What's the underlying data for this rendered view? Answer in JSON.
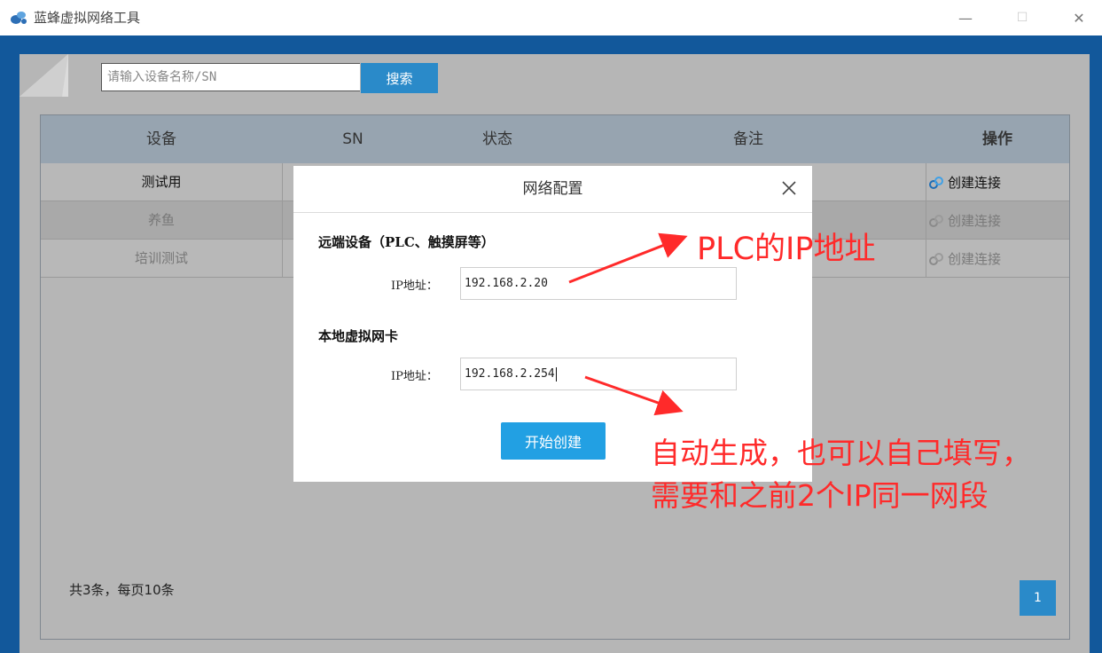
{
  "window": {
    "title": "蓝蜂虚拟网络工具",
    "controls": {
      "minimize": "—",
      "maximize": "☐",
      "close": "✕"
    }
  },
  "search": {
    "placeholder": "请输入设备名称/SN",
    "button_label": "搜索"
  },
  "table": {
    "columns": [
      "设备",
      "SN",
      "状态",
      "备注",
      "操作"
    ],
    "rows": [
      {
        "device": "测试用",
        "action": "创建连接"
      },
      {
        "device": "养鱼",
        "action": "创建连接"
      },
      {
        "device": "培训测试",
        "action": "创建连接"
      }
    ]
  },
  "footer": {
    "summary": "共3条，每页10条",
    "page": "1"
  },
  "modal": {
    "title": "网络配置",
    "remote_section": "远端设备（PLC、触摸屏等）",
    "remote_ip_label": "IP地址：",
    "remote_ip_value": "192.168.2.20",
    "local_section": "本地虚拟网卡",
    "local_ip_label": "IP地址：",
    "local_ip_value": "192.168.2.254",
    "submit_label": "开始创建"
  },
  "annotations": {
    "top": "PLC的IP地址",
    "bottom_line1": "自动生成，也可以自己填写，",
    "bottom_line2": "需要和之前2个IP同一网段"
  },
  "colors": {
    "accent": "#2a8ac9",
    "frame": "#12589b",
    "annotation": "#ff2a2a"
  }
}
